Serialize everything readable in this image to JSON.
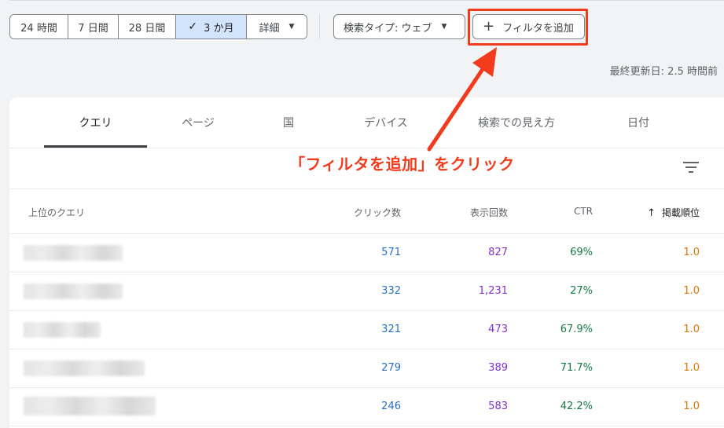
{
  "date_range": {
    "options": [
      "24 時間",
      "7 日間",
      "28 日間",
      "3 か月",
      "詳細"
    ],
    "active": "3 か月"
  },
  "search_type": {
    "label": "検索タイプ: ウェブ"
  },
  "add_filter": {
    "label": "フィルタを追加"
  },
  "last_updated": "最終更新日: 2.5 時間前",
  "tabs": [
    "クエリ",
    "ページ",
    "国",
    "デバイス",
    "検索での見え方",
    "日付"
  ],
  "annotation": "「フィルタを追加」をクリック",
  "table": {
    "headers": {
      "query": "上位のクエリ",
      "clicks": "クリック数",
      "impressions": "表示回数",
      "ctr": "CTR",
      "position": "掲載順位"
    },
    "sort_indicator": "↑",
    "rows": [
      {
        "clicks": "571",
        "impressions": "827",
        "ctr": "69%",
        "position": "1.0"
      },
      {
        "clicks": "332",
        "impressions": "1,231",
        "ctr": "27%",
        "position": "1.0"
      },
      {
        "clicks": "321",
        "impressions": "473",
        "ctr": "67.9%",
        "position": "1.0"
      },
      {
        "clicks": "279",
        "impressions": "389",
        "ctr": "71.7%",
        "position": "1.0"
      },
      {
        "clicks": "246",
        "impressions": "583",
        "ctr": "42.2%",
        "position": "1.0"
      }
    ]
  },
  "colors": {
    "accent_red": "#f23b1c",
    "clicks": "#2670c9",
    "impressions": "#8430ce",
    "ctr": "#137a43",
    "position": "#e37400",
    "active_segment": "#d2e3fc"
  }
}
